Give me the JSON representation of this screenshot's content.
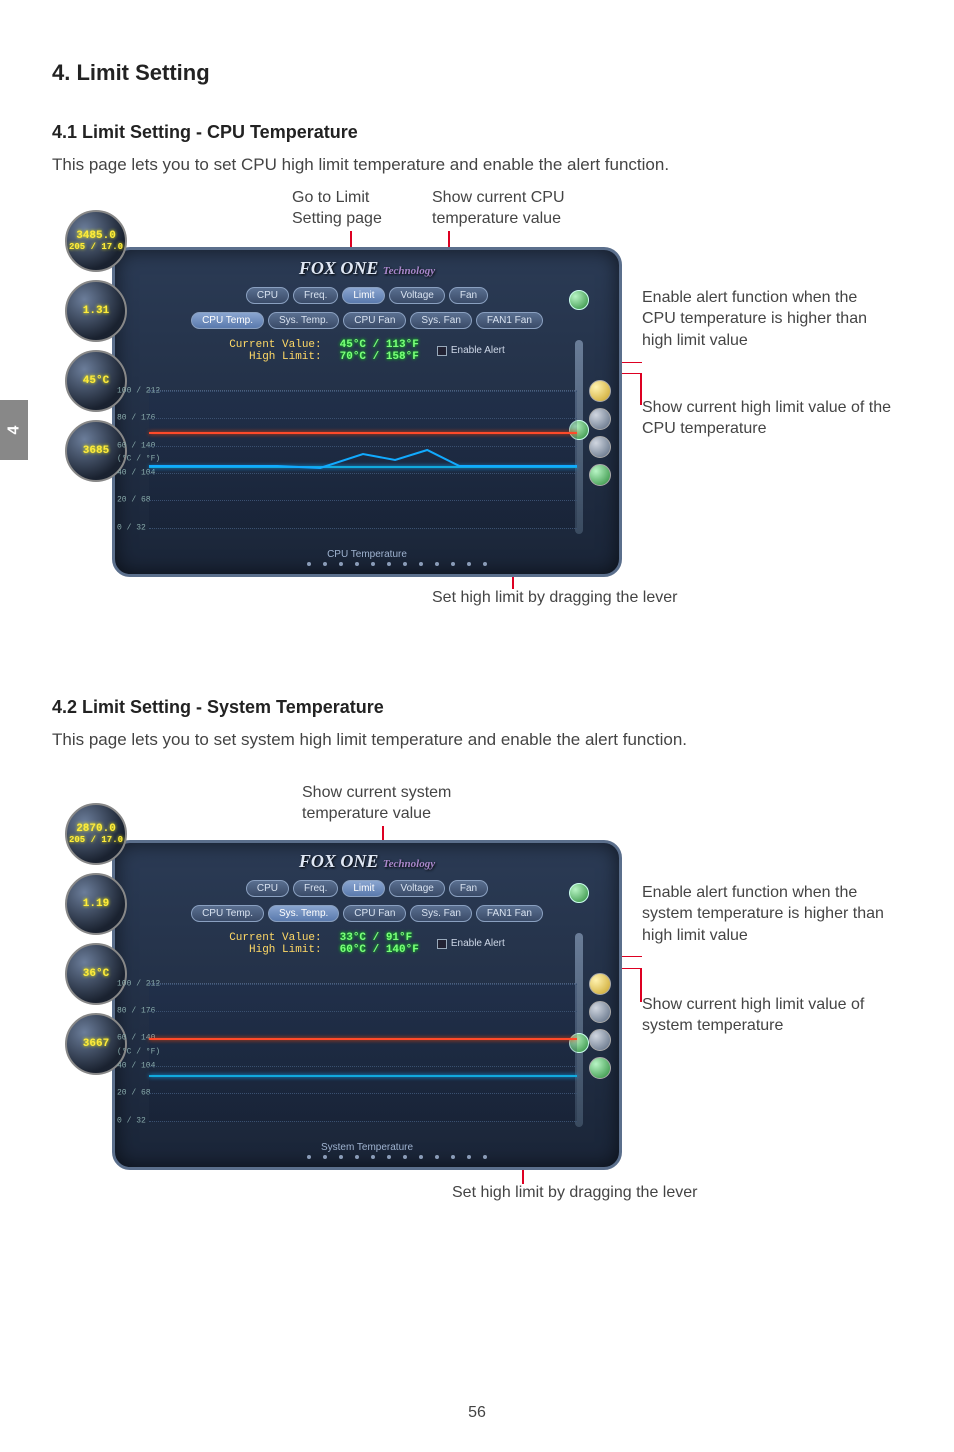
{
  "page_tab": "4",
  "page_number": "56",
  "h1": "4. Limit Setting",
  "s41": {
    "heading": "4.1 Limit Setting - CPU Temperature",
    "body": "This page lets you to set CPU high limit temperature and enable the alert function.",
    "callouts": {
      "go_to_limit": "Go to Limit\nSetting page",
      "show_current": "Show current CPU\ntemperature value",
      "enable_alert": "Enable alert function when the CPU temperature is higher than high limit value",
      "show_high_limit": "Show current high limit value of the CPU temperature",
      "set_lever": "Set high limit by dragging the lever"
    },
    "panel": {
      "brand": "FOX ONE",
      "brand_sub": "Technology",
      "gauges": {
        "freq": "3485.0",
        "fsb": "205 / 17.0",
        "volt": "1.31",
        "temp": "45°C",
        "fan": "3685"
      },
      "tabs1": {
        "cpu": "CPU",
        "freq": "Freq.",
        "limit": "Limit",
        "voltage": "Voltage",
        "fan": "Fan"
      },
      "tabs2": {
        "cpu_temp": "CPU Temp.",
        "sys_temp": "Sys. Temp.",
        "cpu_fan": "CPU Fan",
        "sys_fan": "Sys. Fan",
        "fan1": "FAN1 Fan"
      },
      "readout": {
        "current_label": "Current Value:",
        "current_value": "45°C / 113°F",
        "high_label": "High Limit:",
        "high_value": "70°C / 158°F",
        "enable_alert": "Enable Alert"
      },
      "chart_label": "CPU Temperature",
      "yticks": [
        "100 / 212",
        "80 / 176",
        "60 / 140",
        "(°C / °F)",
        "40 / 104",
        "20 / 68",
        "0 / 32"
      ]
    },
    "chart_data": {
      "type": "line",
      "title": "CPU Temperature",
      "ylabel": "(°C / °F)",
      "ylim_c": [
        0,
        100
      ],
      "yticks_c": [
        0,
        20,
        40,
        60,
        80,
        100
      ],
      "high_limit_c": 70,
      "series": [
        {
          "name": "CPU Temp (°C)",
          "values": [
            45,
            45,
            44,
            45,
            46,
            49,
            46,
            45,
            45,
            45
          ]
        }
      ]
    }
  },
  "s42": {
    "heading": "4.2 Limit Setting - System Temperature",
    "body": "This page lets you to set system high limit temperature and enable the alert function.",
    "callouts": {
      "show_current": "Show current system\ntemperature value",
      "enable_alert": "Enable alert function when the system temperature is higher than high limit value",
      "show_high_limit": "Show current high limit value of system temperature",
      "set_lever": "Set high limit by dragging the lever"
    },
    "panel": {
      "brand": "FOX ONE",
      "brand_sub": "Technology",
      "gauges": {
        "freq": "2870.0",
        "fsb": "205 / 17.0",
        "volt": "1.19",
        "temp": "36°C",
        "fan": "3667"
      },
      "tabs1": {
        "cpu": "CPU",
        "freq": "Freq.",
        "limit": "Limit",
        "voltage": "Voltage",
        "fan": "Fan"
      },
      "tabs2": {
        "cpu_temp": "CPU Temp.",
        "sys_temp": "Sys. Temp.",
        "cpu_fan": "CPU Fan",
        "sys_fan": "Sys. Fan",
        "fan1": "FAN1 Fan"
      },
      "readout": {
        "current_label": "Current Value:",
        "current_value": "33°C / 91°F",
        "high_label": "High Limit:",
        "high_value": "60°C / 140°F",
        "enable_alert": "Enable Alert"
      },
      "chart_label": "System Temperature",
      "yticks": [
        "100 / 212",
        "80 / 176",
        "60 / 140",
        "(°C / °F)",
        "40 / 104",
        "20 / 68",
        "0 / 32"
      ]
    },
    "chart_data": {
      "type": "line",
      "title": "System Temperature",
      "ylabel": "(°C / °F)",
      "ylim_c": [
        0,
        100
      ],
      "yticks_c": [
        0,
        20,
        40,
        60,
        80,
        100
      ],
      "high_limit_c": 60,
      "series": [
        {
          "name": "System Temp (°C)",
          "values": [
            33,
            33,
            33,
            33,
            33,
            33,
            33,
            33,
            33,
            33
          ]
        }
      ]
    }
  }
}
